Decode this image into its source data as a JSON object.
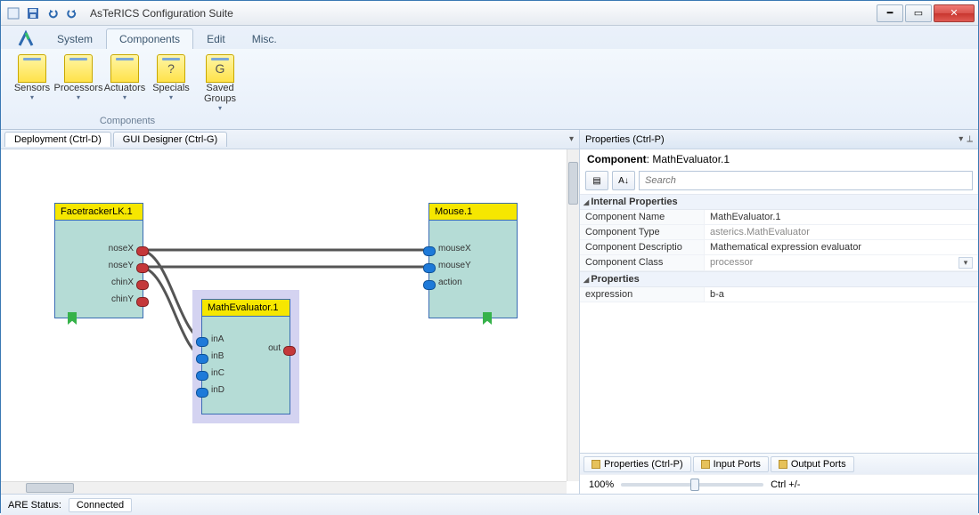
{
  "app_title": "AsTeRICS Configuration Suite",
  "ribbon": {
    "tabs": [
      "System",
      "Components",
      "Edit",
      "Misc."
    ],
    "active_tab": "Components",
    "buttons": [
      {
        "label": "Sensors",
        "glyph": "●●"
      },
      {
        "label": "Processors",
        "glyph": "≡"
      },
      {
        "label": "Actuators",
        "glyph": "≡"
      },
      {
        "label": "Specials",
        "glyph": "?"
      },
      {
        "label": "Saved Groups",
        "glyph": "G"
      }
    ],
    "group_label": "Components"
  },
  "doc_tabs": {
    "deployment": "Deployment (Ctrl-D)",
    "gui": "GUI Designer (Ctrl-G)"
  },
  "canvas": {
    "facetracker": {
      "title": "FacetrackerLK.1",
      "ports": {
        "noseX": "noseX",
        "noseY": "noseY",
        "chinX": "chinX",
        "chinY": "chinY"
      }
    },
    "math": {
      "title": "MathEvaluator.1",
      "in": {
        "inA": "inA",
        "inB": "inB",
        "inC": "inC",
        "inD": "inD"
      },
      "out": "out"
    },
    "mouse": {
      "title": "Mouse.1",
      "in": {
        "mouseX": "mouseX",
        "mouseY": "mouseY",
        "action": "action"
      }
    }
  },
  "properties": {
    "panel_title": "Properties (Ctrl-P)",
    "component_label": "Component",
    "component_value": "MathEvaluator.1",
    "search_placeholder": "Search",
    "sections": {
      "internal": "Internal Properties",
      "props": "Properties"
    },
    "rows": {
      "comp_name_k": "Component Name",
      "comp_name_v": "MathEvaluator.1",
      "comp_type_k": "Component Type",
      "comp_type_v": "asterics.MathEvaluator",
      "comp_desc_k": "Component Descriptio",
      "comp_desc_v": "Mathematical expression evaluator",
      "comp_class_k": "Component Class",
      "comp_class_v": "processor",
      "expression_k": "expression",
      "expression_v": "b-a"
    },
    "bottom_tabs": {
      "props": "Properties (Ctrl-P)",
      "inports": "Input Ports",
      "outports": "Output Ports"
    },
    "zoom_pct": "100%",
    "zoom_hint": "Ctrl +/-"
  },
  "status": {
    "label": "ARE Status:",
    "value": "Connected"
  }
}
